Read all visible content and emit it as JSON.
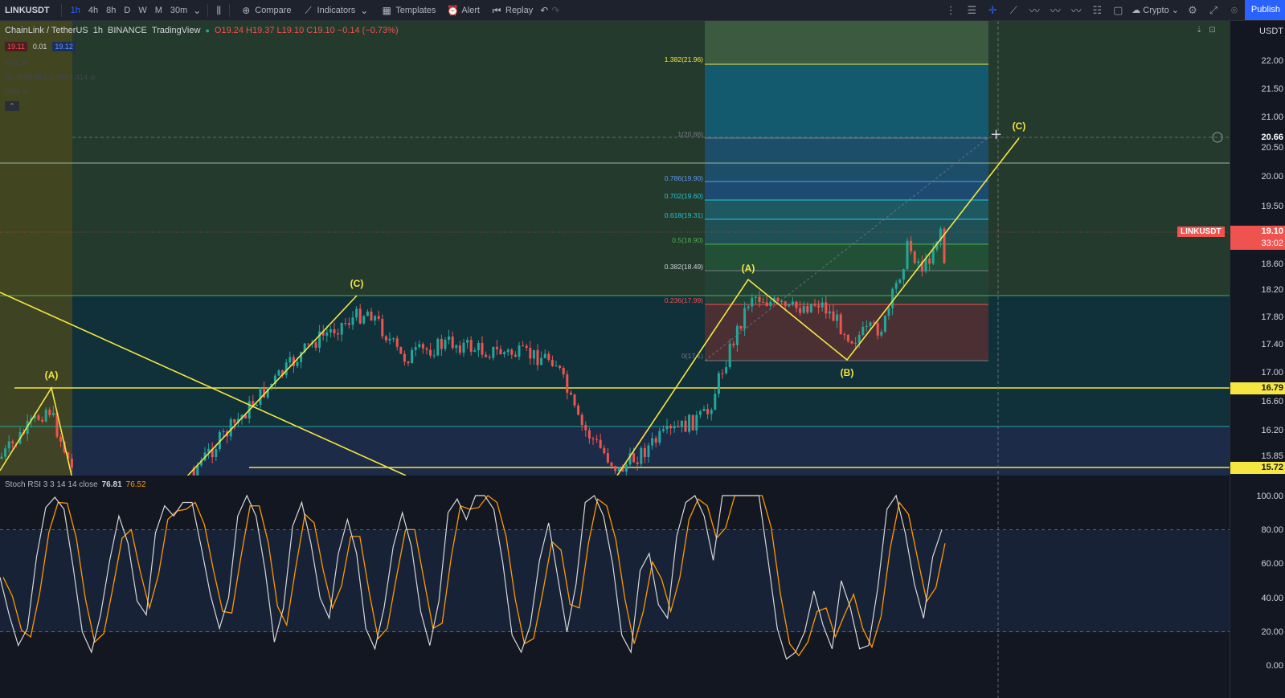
{
  "toolbar": {
    "symbol": "LINKUSDT",
    "timeframes": [
      "1h",
      "4h",
      "8h",
      "D",
      "W",
      "M",
      "30m"
    ],
    "compare": "Compare",
    "indicators": "Indicators",
    "templates": "Templates",
    "alert": "Alert",
    "replay": "Replay",
    "crypto": "Crypto",
    "publish": "Publish"
  },
  "legend": {
    "title": "ChainLink / TetherUS",
    "interval": "1h",
    "exchange": "BINANCE",
    "source": "TradingView",
    "ohlc": "O19.24 H19.37 L19.10 C19.10 −0.14 (−0.73%)",
    "bid": "19.11",
    "spread": "0.01",
    "ask": "19.12",
    "hidden1": "VOL",
    "hidden2": "SC [DN] 56 2.4 144 1.414",
    "hidden3": "EMA"
  },
  "fib_labels": [
    "1.382(21.96)",
    "1(20.66)",
    "0.786(19.90)",
    "0.702(19.60)",
    "0.618(19.31)",
    "0.5(18.90)",
    "0.382(18.49)",
    "0.236(17.99)",
    "0(17.1)"
  ],
  "waves": [
    "(A)",
    "(C)",
    "(A)",
    "(B)",
    "(C)"
  ],
  "price_axis": {
    "unit": "USDT",
    "ticks": [
      "22.00",
      "21.50",
      "21.00",
      "20.50",
      "20.00",
      "19.50",
      "18.60",
      "18.20",
      "17.80",
      "17.40",
      "17.00",
      "16.60",
      "16.20",
      "15.85"
    ],
    "crosshair_price": "20.66",
    "current_price": "19.10",
    "countdown": "33:02",
    "level_1679": "16.79",
    "level_1572": "15.72"
  },
  "ticker_tag": "LINKUSDT",
  "stoch": {
    "label": "Stoch RSI 3 3 14 14 close",
    "k": "76.81",
    "d": "76.52",
    "ticks": [
      "100.00",
      "80.00",
      "60.00",
      "40.00",
      "20.00",
      "0.00"
    ],
    "k_series": [
      52,
      30,
      12,
      22,
      64,
      93,
      99,
      92,
      58,
      20,
      8,
      30,
      62,
      88,
      72,
      38,
      30,
      78,
      94,
      88,
      96,
      96,
      70,
      42,
      22,
      40,
      88,
      100,
      88,
      56,
      14,
      34,
      82,
      96,
      72,
      40,
      28,
      66,
      86,
      66,
      22,
      10,
      34,
      70,
      90,
      70,
      32,
      12,
      38,
      90,
      98,
      86,
      100,
      100,
      92,
      60,
      18,
      8,
      24,
      62,
      84,
      52,
      20,
      48,
      96,
      100,
      88,
      60,
      18,
      8,
      56,
      66,
      36,
      28,
      76,
      96,
      100,
      88,
      62,
      100,
      100,
      100,
      100,
      100,
      62,
      22,
      4,
      8,
      20,
      44,
      24,
      10,
      50,
      34,
      10,
      12,
      46,
      92,
      100,
      78,
      48,
      28,
      64,
      80
    ]
  },
  "colors": {
    "up": "#26a69a",
    "down": "#ef5350",
    "wave": "#f5e642",
    "k": "#d8d8d8",
    "d": "#ff9800"
  }
}
